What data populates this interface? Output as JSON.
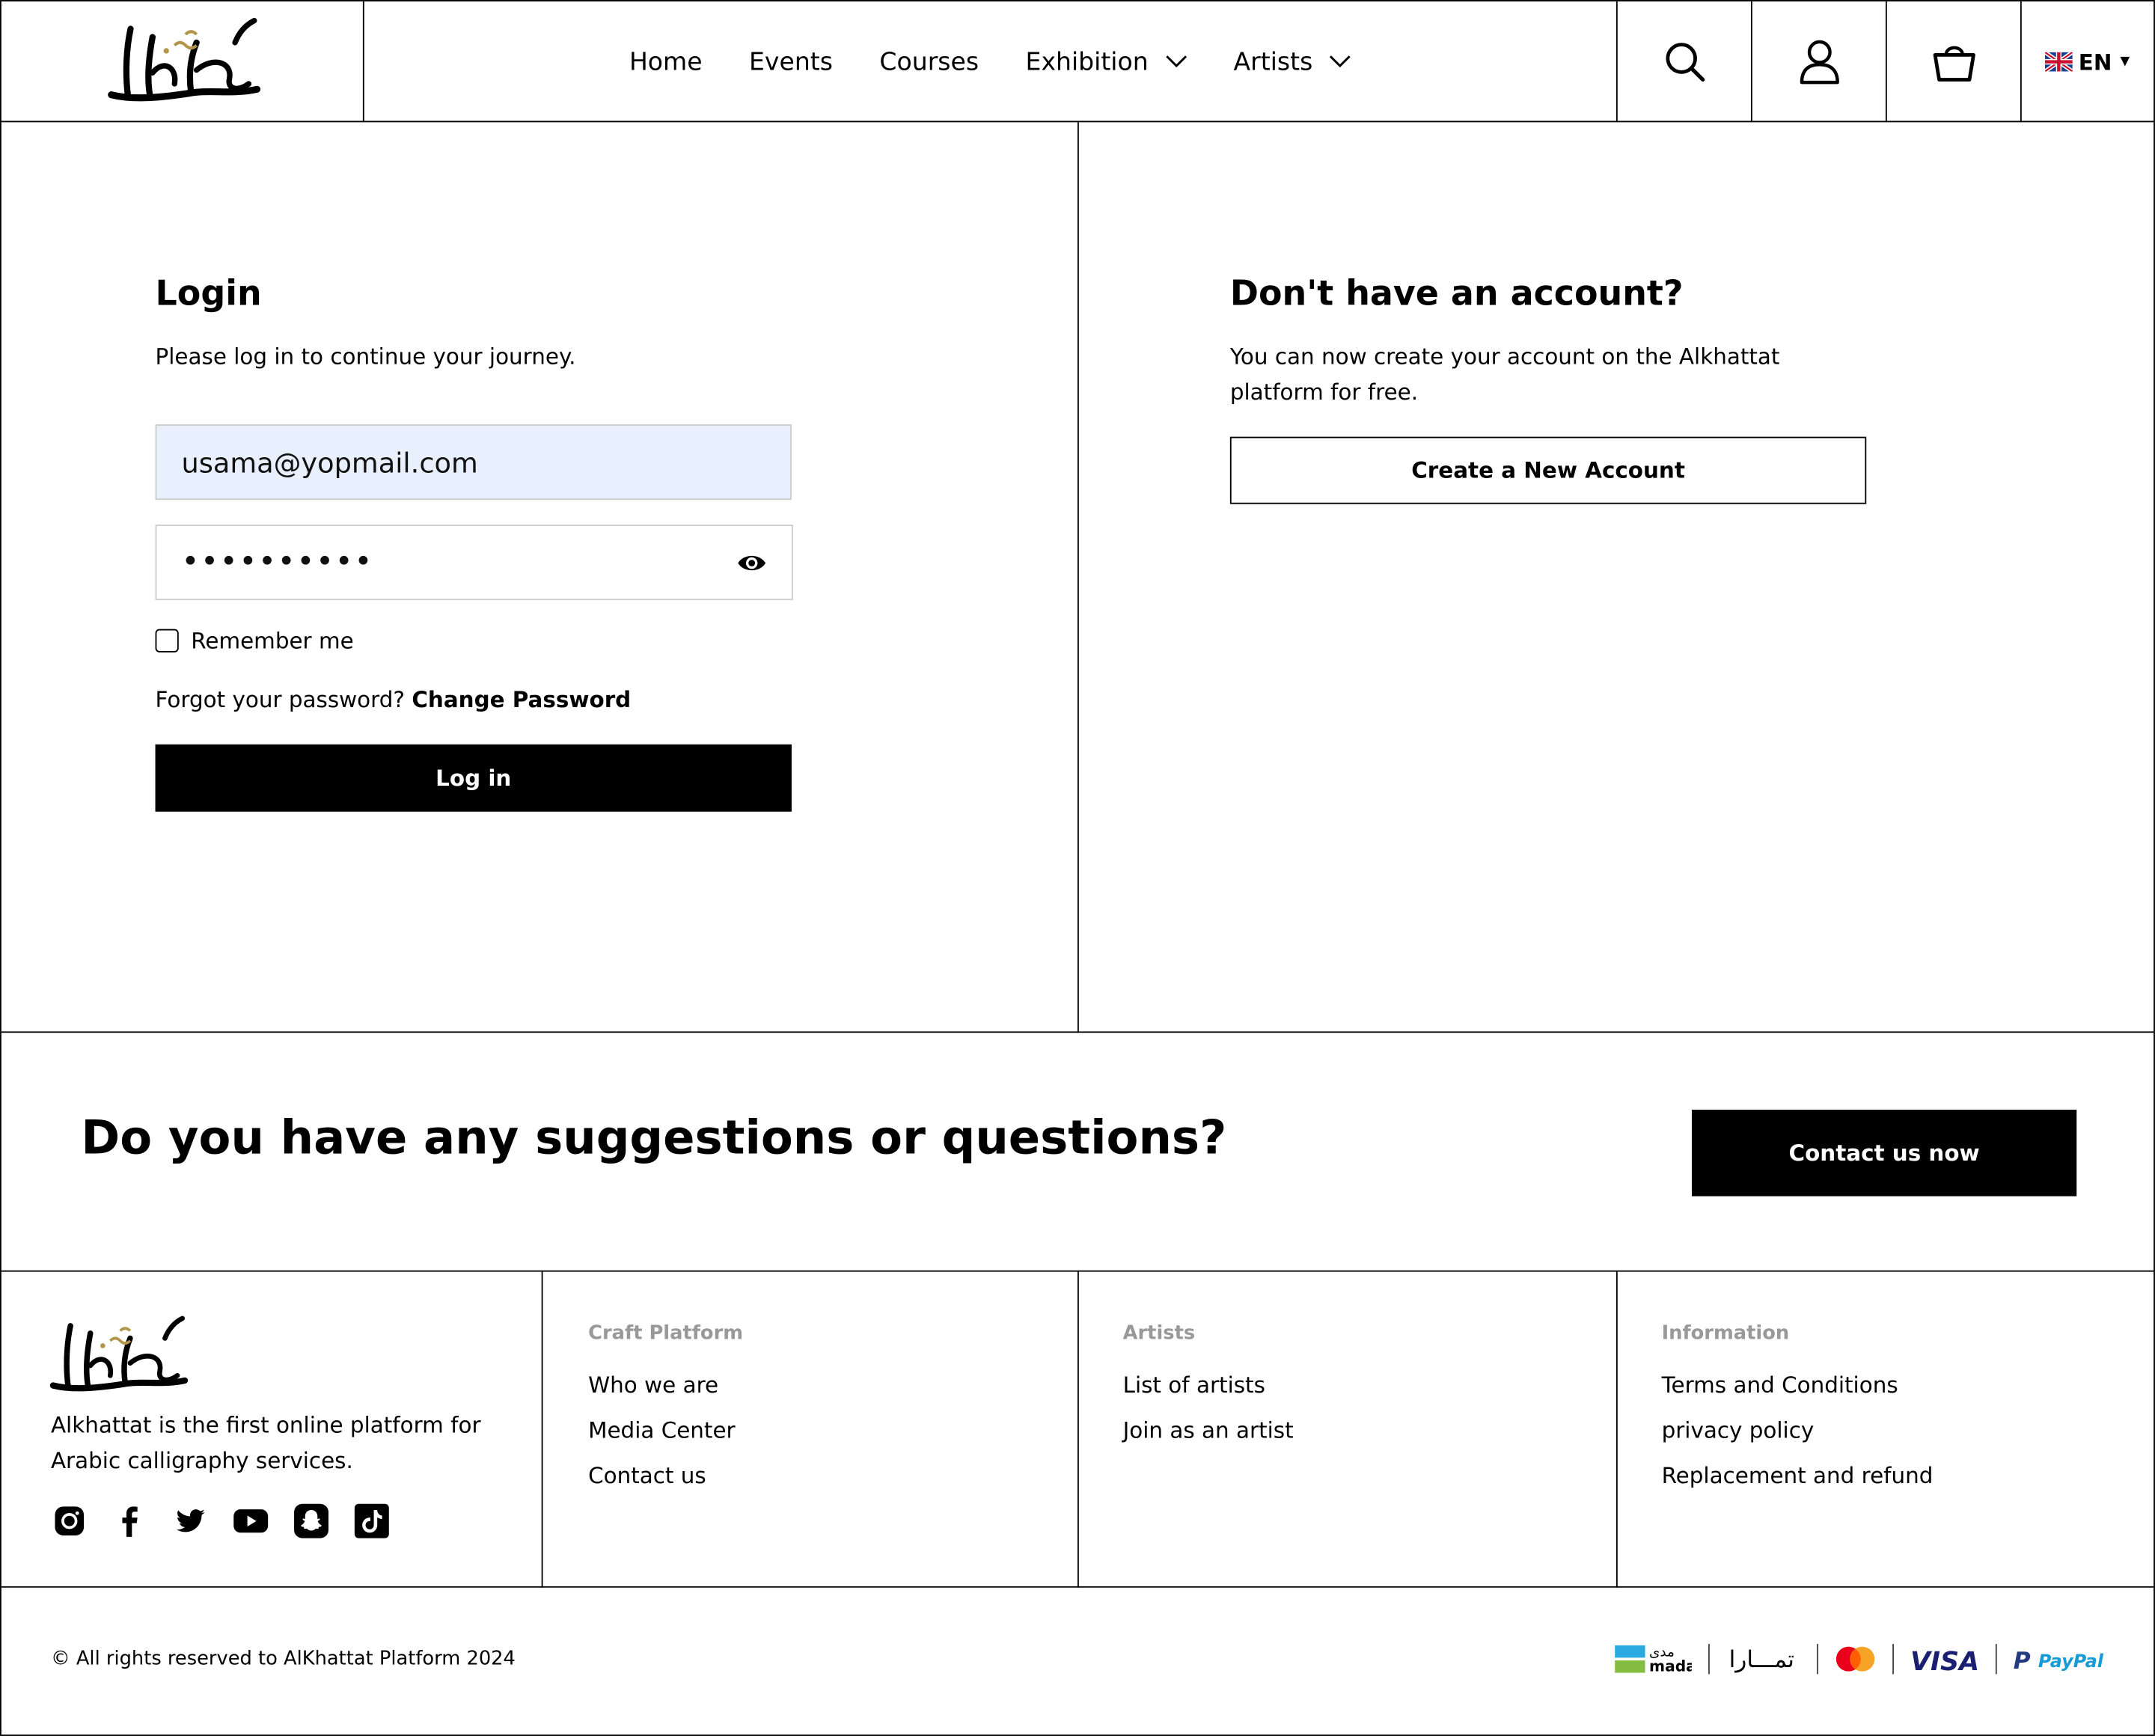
{
  "header": {
    "nav": [
      {
        "label": "Home"
      },
      {
        "label": "Events"
      },
      {
        "label": "Courses"
      },
      {
        "label": "Exhibition"
      },
      {
        "label": "Artists"
      }
    ],
    "language": "EN"
  },
  "login": {
    "title": "Login",
    "subtitle": "Please log in to continue your journey.",
    "email_value": "usama@yopmail.com",
    "password_value": "••••••••••",
    "remember_label": "Remember me",
    "forgot_text": "Forgot your password?",
    "change_password_link": "Change Password",
    "submit_label": "Log in"
  },
  "register": {
    "title": "Don't have an account?",
    "text": "You can now create your account on the Alkhattat platform for free.",
    "button_label": "Create a New Account"
  },
  "cta": {
    "title": "Do you have any suggestions or questions?",
    "button_label": "Contact us now"
  },
  "footer": {
    "about": "Alkhattat is the first online platform for Arabic calligraphy services.",
    "socials": [
      "instagram-icon",
      "facebook-icon",
      "twitter-icon",
      "youtube-icon",
      "snapchat-icon",
      "tiktok-icon"
    ],
    "columns": [
      {
        "heading": "Craft Platform",
        "links": [
          "Who we are",
          "Media Center",
          "Contact us"
        ]
      },
      {
        "heading": "Artists",
        "links": [
          "List of artists",
          "Join as an artist"
        ]
      },
      {
        "heading": "Information",
        "links": [
          "Terms and Conditions",
          "privacy policy",
          "Replacement and refund"
        ]
      }
    ],
    "copyright": "© All rights reserved to AlKhattat Platform 2024",
    "payments": {
      "mada_ar": "مدى",
      "mada_en": "mada",
      "tamara": "تمـــارا",
      "visa": "VISA",
      "paypal": "PayPal"
    }
  },
  "colors": {
    "accent_gold": "#b3954a",
    "email_fill": "#e8f0fe",
    "muted_heading": "#999999"
  }
}
